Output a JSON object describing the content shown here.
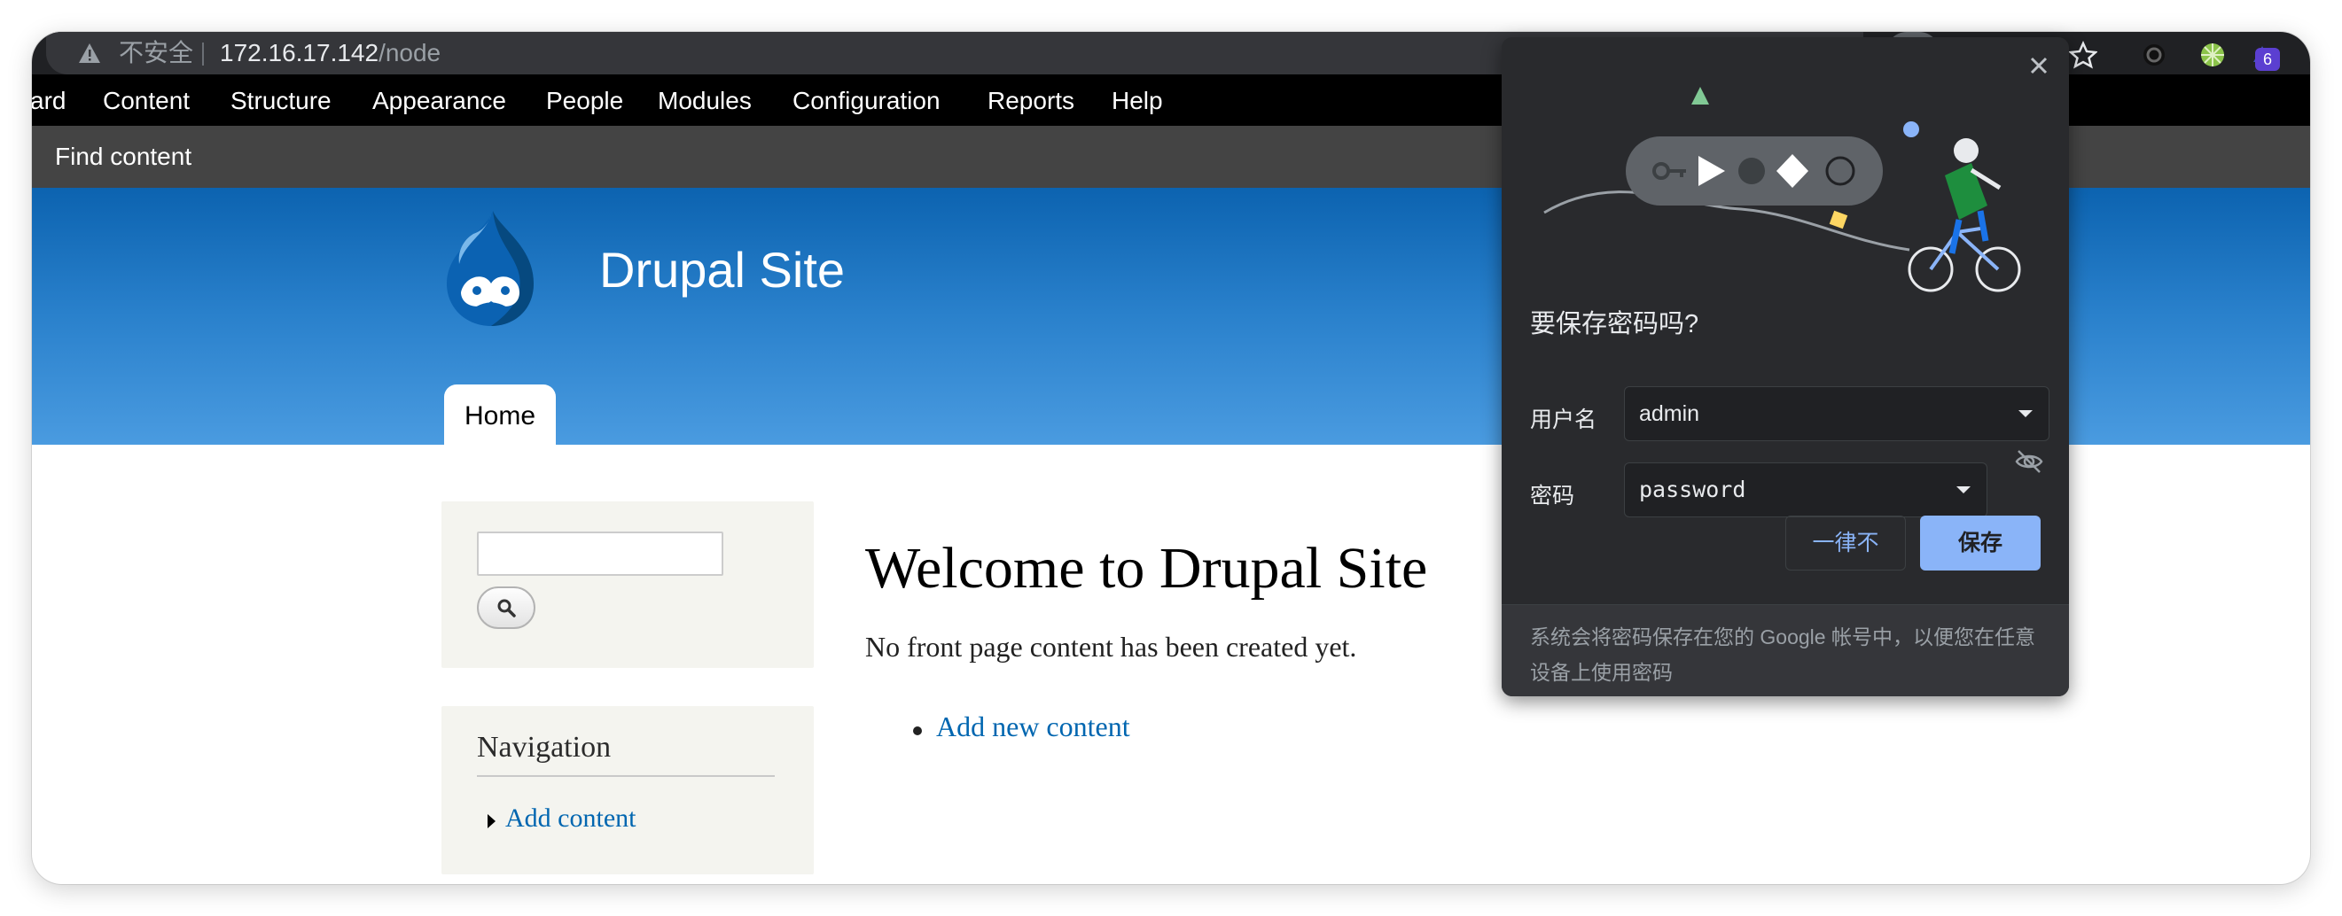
{
  "browser": {
    "insecure_label": "不安全",
    "url_host": "172.16.17.142",
    "url_path": "/node",
    "extension_badge": "6"
  },
  "admin_toolbar": {
    "items": [
      "ard",
      "Content",
      "Structure",
      "Appearance",
      "People",
      "Modules",
      "Configuration",
      "Reports",
      "Help"
    ],
    "shortcut": "Find content"
  },
  "header": {
    "site_name": "Drupal Site",
    "tab_home": "Home",
    "brand_color": "#0c63b0"
  },
  "sidebar": {
    "search_value": "",
    "navigation_title": "Navigation",
    "navigation_link": "Add content"
  },
  "main": {
    "title": "Welcome to Drupal Site",
    "empty_text": "No front page content has been created yet.",
    "add_link": "Add new content"
  },
  "password_popup": {
    "title": "要保存密码吗?",
    "username_label": "用户名",
    "username_value": "admin",
    "password_label": "密码",
    "password_value": "password",
    "never_button": "一律不",
    "save_button": "保存",
    "footer": "系统会将密码保存在您的 Google 帐号中，以便您在任意设备上使用密码",
    "accent_color": "#8ab4f8"
  }
}
